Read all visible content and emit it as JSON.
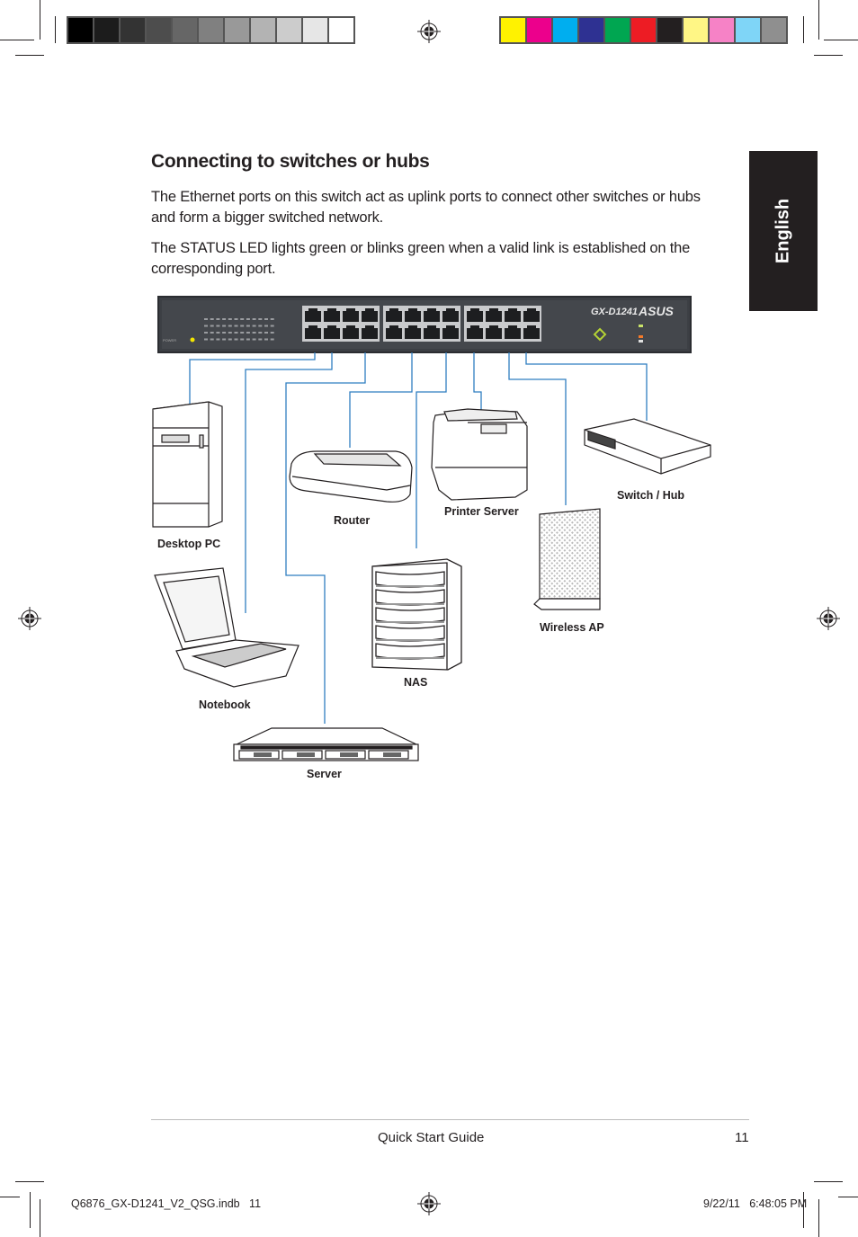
{
  "print_marks": {
    "grayscale_swatches": [
      "#000000",
      "#1c1c1c",
      "#333333",
      "#4d4d4d",
      "#666666",
      "#808080",
      "#999999",
      "#b3b3b3",
      "#cccccc",
      "#e6e6e6",
      "#ffffff"
    ],
    "color_swatches": [
      "#fff200",
      "#ec008c",
      "#00aeef",
      "#2e3192",
      "#00a651",
      "#ed1c24",
      "#231f20",
      "#fff685",
      "#f682c6",
      "#7fd5f7",
      "#8f8f8f"
    ]
  },
  "side_tab": {
    "label": "English"
  },
  "section": {
    "title": "Connecting to switches or hubs",
    "paragraphs": [
      "The Ethernet ports on this switch act as uplink ports to connect other switches or hubs and form a bigger switched network.",
      "The STATUS LED lights green or blinks green when a valid link is established on the corresponding port."
    ]
  },
  "switch_device": {
    "model": "GX-D1241",
    "brand": "ASUS",
    "port_count": 24
  },
  "devices": {
    "desktop_pc": "Desktop PC",
    "router": "Router",
    "printer_server": "Printer Server",
    "switch_hub": "Switch / Hub",
    "notebook": "Notebook",
    "nas": "NAS",
    "wireless_ap": "Wireless AP",
    "server": "Server"
  },
  "colors": {
    "cable": "#2f7ec1",
    "switch_body": "#3c3f44",
    "text": "#231f20"
  },
  "footer": {
    "guide_title": "Quick Start Guide",
    "page_number": "11"
  },
  "slug": {
    "file_name": "Q6876_GX-D1241_V2_QSG.indb   11",
    "timestamp": "9/22/11   6:48:05 PM"
  }
}
